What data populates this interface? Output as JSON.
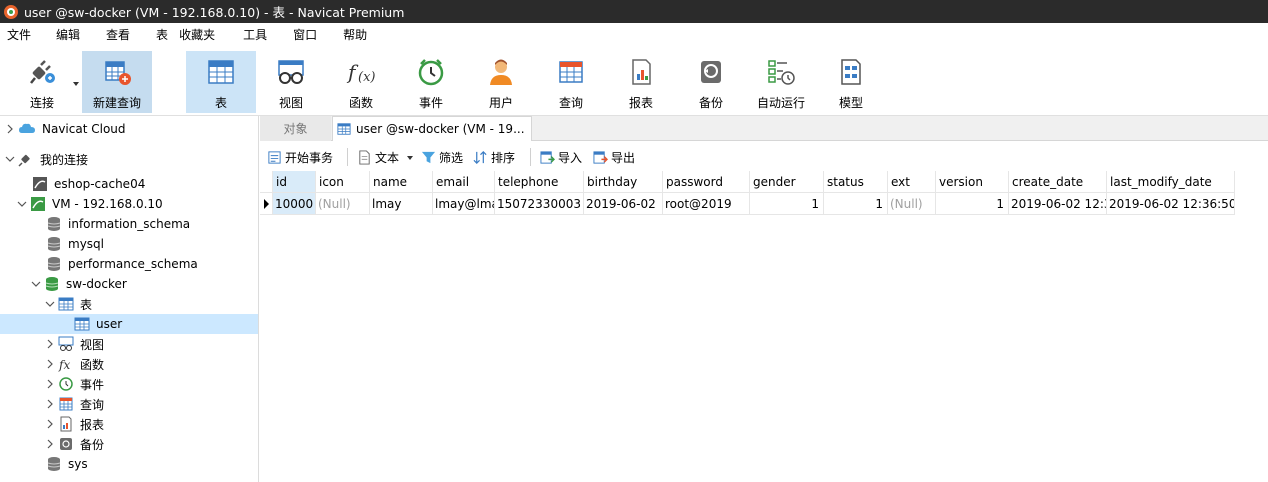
{
  "window": {
    "title": "user @sw-docker (VM - 192.168.0.10) - 表 - Navicat Premium"
  },
  "menu": [
    "文件",
    "编辑",
    "查看",
    "表",
    "收藏夹",
    "工具",
    "窗口",
    "帮助"
  ],
  "toolbar": {
    "connect": "连接",
    "new_query": "新建查询",
    "table": "表",
    "view": "视图",
    "function": "函数",
    "event": "事件",
    "user": "用户",
    "query": "查询",
    "report": "报表",
    "backup": "备份",
    "automation": "自动运行",
    "model": "模型"
  },
  "sidebar": {
    "navicat_cloud": "Navicat Cloud",
    "my_connections": "我的连接",
    "conn1": "eshop-cache04",
    "conn2": "VM - 192.168.0.10",
    "db1": "information_schema",
    "db2": "mysql",
    "db3": "performance_schema",
    "db4": "sw-docker",
    "tables": "表",
    "table_user": "user",
    "views": "视图",
    "functions": "函数",
    "events": "事件",
    "queries": "查询",
    "reports": "报表",
    "backups": "备份",
    "db5": "sys"
  },
  "tabs": {
    "objects": "对象",
    "current": "user @sw-docker (VM - 19..."
  },
  "subtoolbar": {
    "begin_tx": "开始事务",
    "text": "文本",
    "filter": "筛选",
    "sort": "排序",
    "import": "导入",
    "export": "导出"
  },
  "grid": {
    "columns": [
      "id",
      "icon",
      "name",
      "email",
      "telephone",
      "birthday",
      "password",
      "gender",
      "status",
      "ext",
      "version",
      "create_date",
      "last_modify_date"
    ],
    "rows": [
      [
        "10000",
        "(Null)",
        "lmay",
        "lmay@lma",
        "15072330003",
        "2019-06-02",
        "root@2019",
        "1",
        "1",
        "(Null)",
        "1",
        "2019-06-02 12:3",
        "2019-06-02 12:36:50"
      ]
    ]
  }
}
